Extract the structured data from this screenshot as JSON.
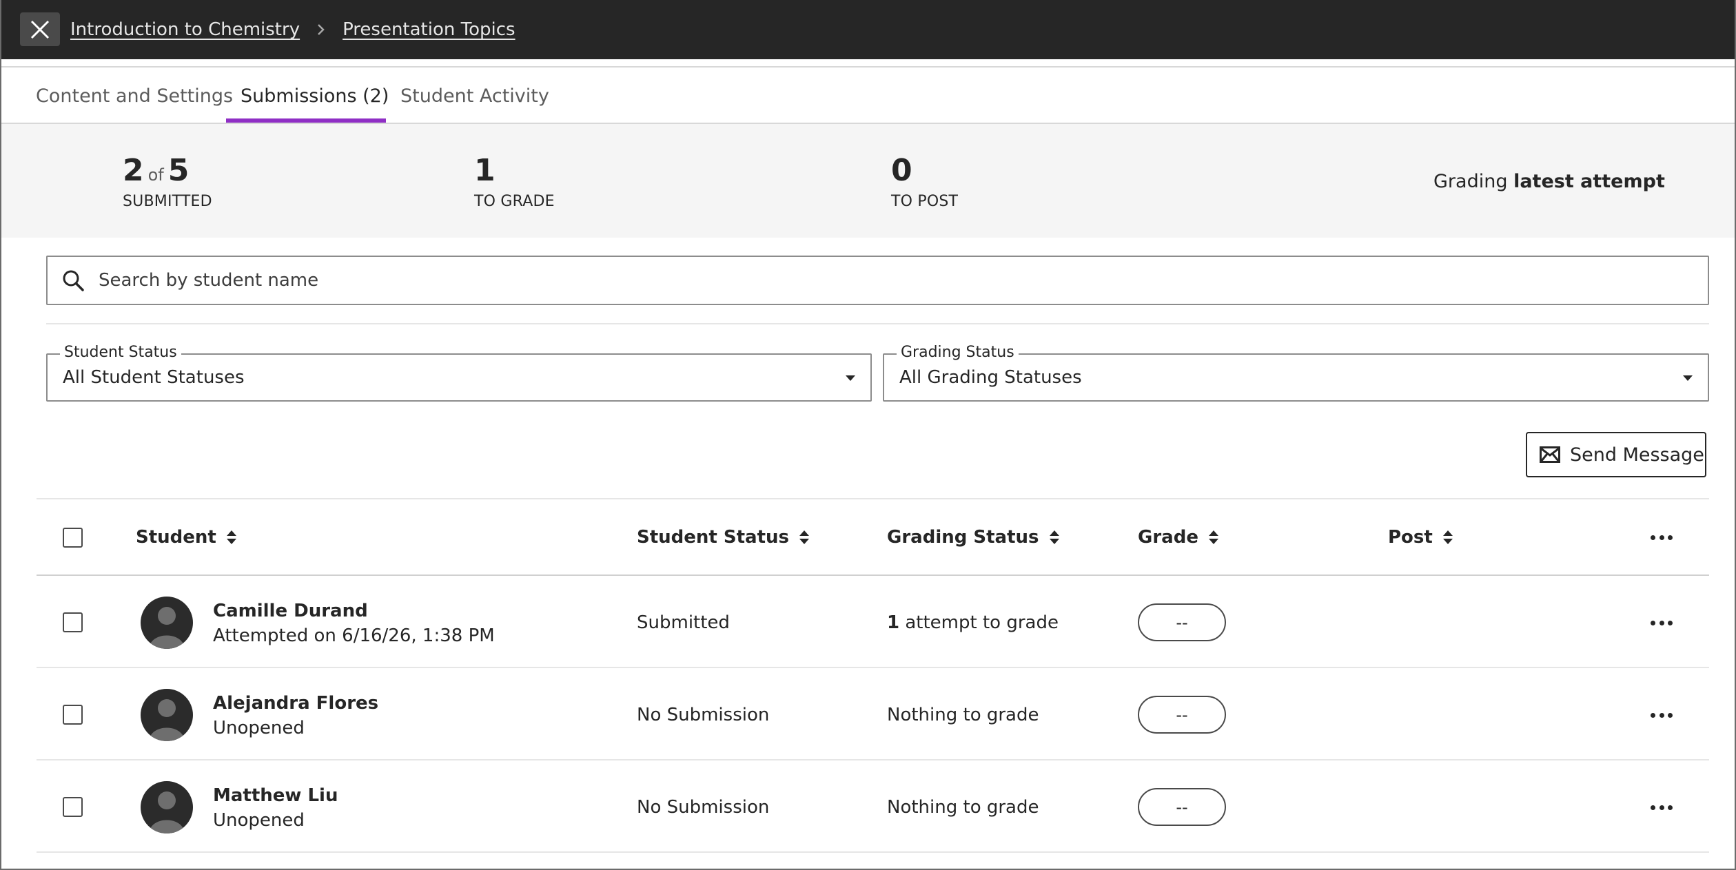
{
  "topbar": {
    "breadcrumbs": [
      "Introduction to Chemistry",
      "Presentation Topics"
    ]
  },
  "tabs": [
    {
      "label": "Content and Settings",
      "active": false
    },
    {
      "label": "Submissions (2)",
      "active": true
    },
    {
      "label": "Student Activity",
      "active": false
    }
  ],
  "summary": {
    "submitted": {
      "count": "2",
      "of": "of",
      "total": "5",
      "label": "SUBMITTED"
    },
    "to_grade": {
      "count": "1",
      "label": "TO GRADE"
    },
    "to_post": {
      "count": "0",
      "label": "TO POST"
    },
    "grading_prefix": "Grading",
    "grading_mode": "latest attempt"
  },
  "search": {
    "placeholder": "Search by student name",
    "value": ""
  },
  "filters": {
    "student_status": {
      "label": "Student Status",
      "value": "All Student Statuses"
    },
    "grading_status": {
      "label": "Grading Status",
      "value": "All Grading Statuses"
    }
  },
  "actions": {
    "send_message": "Send Message"
  },
  "table": {
    "headers": {
      "student": "Student",
      "student_status": "Student Status",
      "grading_status": "Grading Status",
      "grade": "Grade",
      "post": "Post"
    },
    "rows": [
      {
        "name": "Camille Durand",
        "sub": "Attempted on 6/16/26, 1:38 PM",
        "status": "Submitted",
        "grading_count": "1",
        "grading_text": "attempt to grade",
        "grade": "--"
      },
      {
        "name": "Alejandra Flores",
        "sub": "Unopened",
        "status": "No Submission",
        "grading_count": "",
        "grading_text": "Nothing to grade",
        "grade": "--"
      },
      {
        "name": "Matthew Liu",
        "sub": "Unopened",
        "status": "No Submission",
        "grading_count": "",
        "grading_text": "Nothing to grade",
        "grade": "--"
      }
    ]
  },
  "colors": {
    "topbar_bg": "#262626",
    "tab_accent": "#8f2fc5",
    "summary_bg": "#f5f5f5"
  }
}
